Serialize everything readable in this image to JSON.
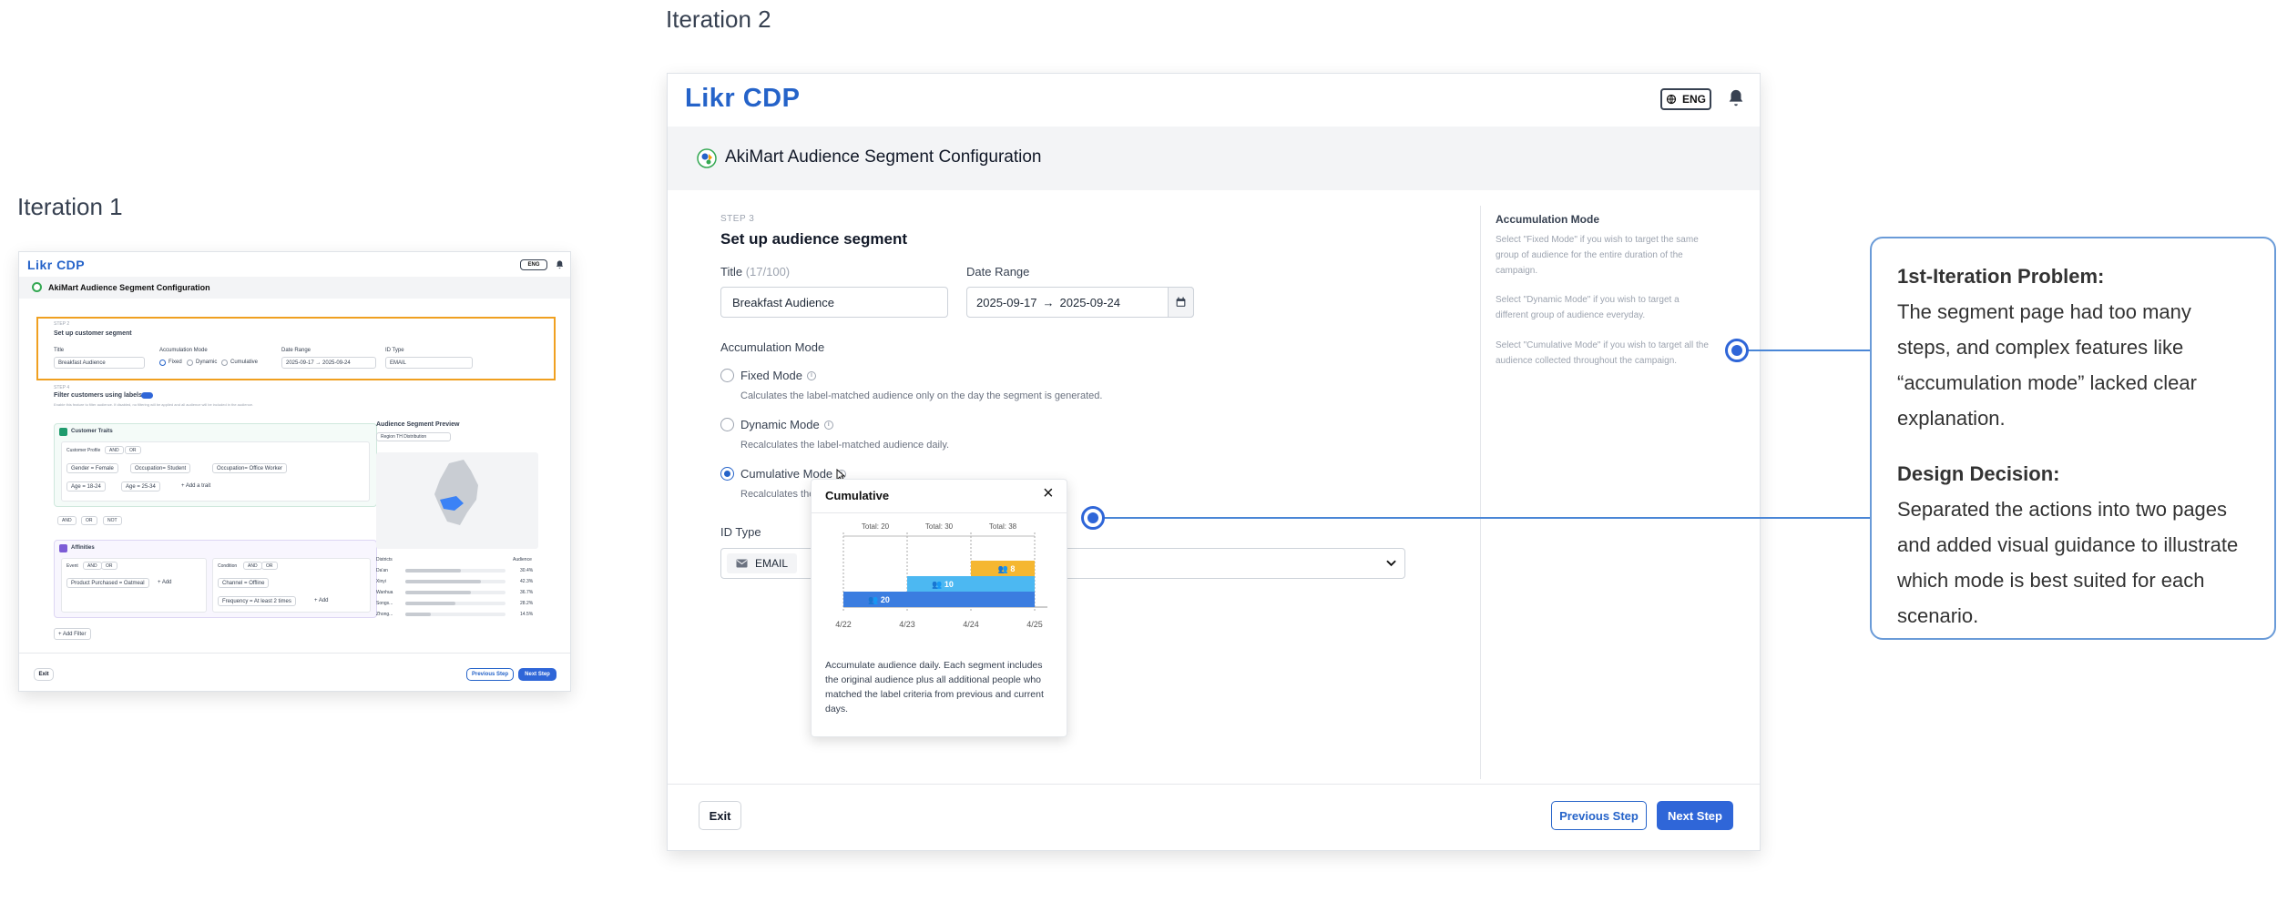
{
  "labels": {
    "iteration1": "Iteration 1",
    "iteration2": "Iteration 2"
  },
  "app": {
    "logo": "Likr CDP",
    "lang": "ENG",
    "page_title": "AkiMart Audience Segment Configuration"
  },
  "thumb": {
    "step": "STEP 2",
    "heading": "Set up customer segment",
    "fields": {
      "title": "Title",
      "title_value": "Breakfast Audience",
      "accum": "Accumulation Mode",
      "opt_fixed": "Fixed",
      "opt_dynamic": "Dynamic",
      "opt_cumulative": "Cumulative",
      "date": "Date Range",
      "date_value": "2025-09-17 → 2025-09-24",
      "idtype": "ID Type",
      "idtype_value": "EMAIL"
    },
    "step4": "STEP 4",
    "filter_label": "Filter customers using labels",
    "filter_note": "Enable this feature to filter audience. If disabled, no filtering will be applied and all audience will be included in the audience.",
    "traits": {
      "title": "Customer Traits",
      "profile": "Customer Profile",
      "and": "AND",
      "or": "OR",
      "chips": [
        "Gender = Female",
        "Occupation= Student",
        "Occupation= Office Worker",
        "Age = 18-24",
        "Age = 25-34"
      ],
      "add": "+ Add a trait"
    },
    "logic": [
      "AND",
      "OR",
      "NOT"
    ],
    "affinities": {
      "title": "Affinities",
      "event": "Event",
      "condition": "Condition",
      "and": "AND",
      "or": "OR",
      "event_chip": "Product Purchased = Oatmeal",
      "add": "+ Add",
      "cond_chips": [
        "Channel = Offline",
        "Frequency = At least 2 times"
      ]
    },
    "add_filter": "+ Add Filter",
    "preview": {
      "title": "Audience Segment Preview",
      "select": "Region TH Distribution",
      "col_district": "Districts",
      "col_audience": "Audience",
      "rows": [
        {
          "name": "Da'an",
          "pct": "30.4%",
          "v": 0.55
        },
        {
          "name": "Xinyi",
          "pct": "42.3%",
          "v": 0.75
        },
        {
          "name": "Wanhua",
          "pct": "36.7%",
          "v": 0.65
        },
        {
          "name": "Songs...",
          "pct": "28.2%",
          "v": 0.5
        },
        {
          "name": "Zhong...",
          "pct": "14.5%",
          "v": 0.25
        }
      ]
    },
    "btn_exit": "Exit",
    "btn_prev": "Previous Step",
    "btn_next": "Next Step"
  },
  "main": {
    "step": "STEP 3",
    "heading": "Set up audience segment",
    "title_label": "Title",
    "title_count": "(17/100)",
    "title_value": "Breakfast Audience",
    "date_label": "Date Range",
    "date_from": "2025-09-17",
    "date_arrow": "→",
    "date_to": "2025-09-24",
    "accum_label": "Accumulation Mode",
    "modes": [
      {
        "label": "Fixed Mode",
        "desc": "Calculates the label-matched audience only on the day the segment is generated."
      },
      {
        "label": "Dynamic Mode",
        "desc": "Recalculates the label-matched audience daily."
      },
      {
        "label": "Cumulative Mode",
        "desc": "Recalculates the"
      }
    ],
    "idtype_label": "ID Type",
    "idtype_value": "EMAIL",
    "side_title": "Accumulation Mode",
    "side_paras": [
      "Select \"Fixed Mode\" if you wish to target the same group of audience for the entire duration of the campaign.",
      "Select \"Dynamic Mode\" if you wish to target a different group of audience everyday.",
      "Select \"Cumulative Mode\" if you wish to target all the audience collected throughout the campaign."
    ],
    "btn_exit": "Exit",
    "btn_prev": "Previous Step",
    "btn_next": "Next Step"
  },
  "popup": {
    "title": "Cumulative",
    "close": "×",
    "desc": "Accumulate audience daily. Each segment includes the original audience plus all additional people who matched the label criteria from previous and current days."
  },
  "chart_data": {
    "type": "bar",
    "categories": [
      "4/22",
      "4/23",
      "4/24",
      "4/25"
    ],
    "totals": [
      "Total: 20",
      "Total: 30",
      "Total: 38"
    ],
    "series": [
      {
        "values": [
          20,
          20,
          20
        ],
        "label": "20"
      },
      {
        "values": [
          0,
          10,
          10
        ],
        "label": "10"
      },
      {
        "values": [
          0,
          0,
          8
        ],
        "label": "8"
      }
    ],
    "colors": [
      "#3b7de0",
      "#4cb8f2",
      "#f5b731"
    ]
  },
  "callout": {
    "problem_head": "1st-Iteration Problem:",
    "problem_text": "The segment page had too many steps, and complex features like “accumulation mode” lacked clear explanation.",
    "decision_head": "Design Decision:",
    "decision_text": "Separated the actions into two pages and added visual guidance to illustrate which mode is best suited for each scenario."
  }
}
